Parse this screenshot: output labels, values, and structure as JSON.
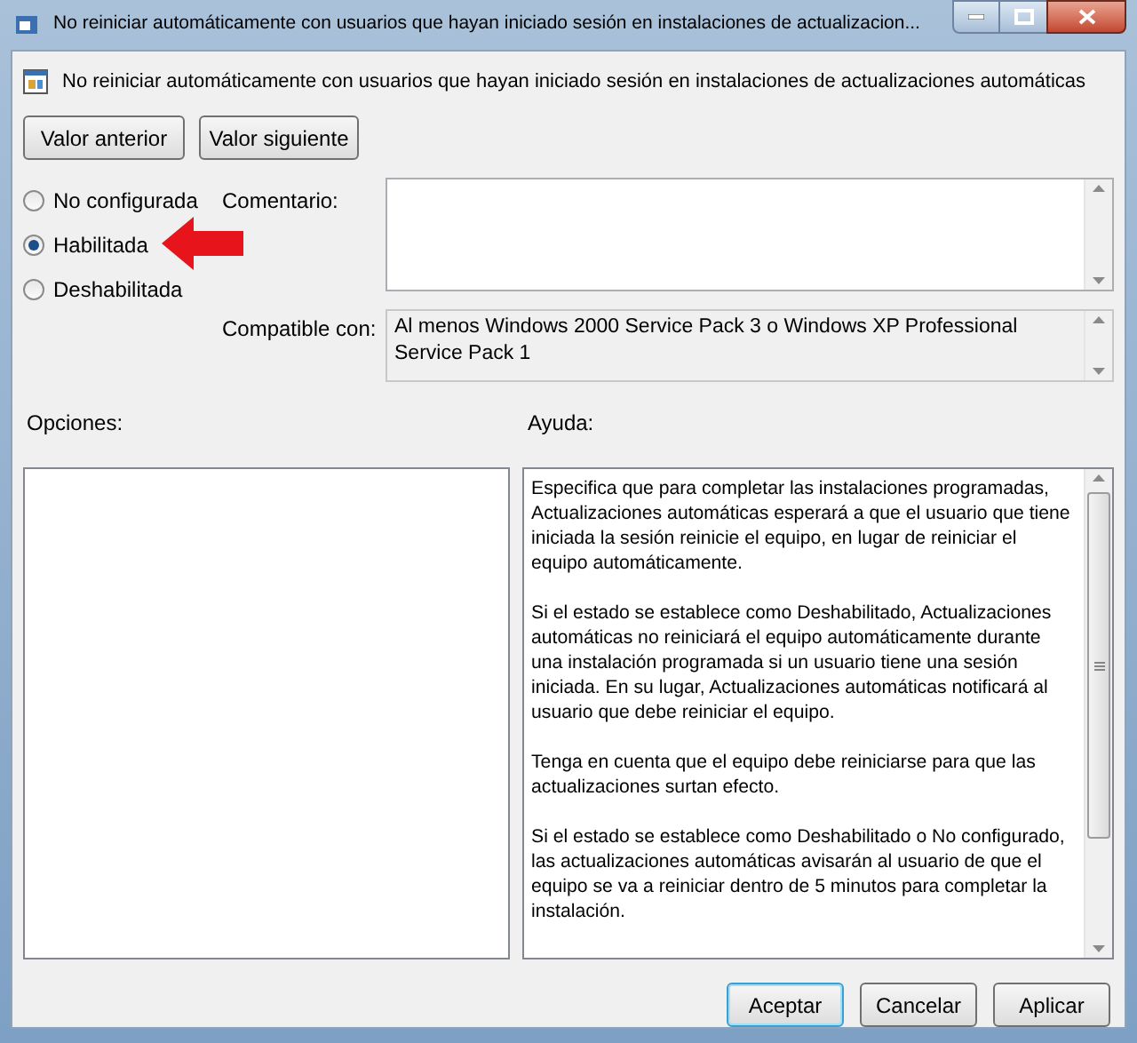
{
  "window": {
    "title": "No reiniciar automáticamente con usuarios que hayan iniciado sesión en instalaciones de actualizacion..."
  },
  "policy_title": "No reiniciar automáticamente con usuarios que hayan iniciado sesión en instalaciones de actualizaciones automáticas",
  "nav_buttons": [
    "Valor anterior",
    "Valor siguiente"
  ],
  "states": [
    {
      "label": "No configurada",
      "selected": false
    },
    {
      "label": "Habilitada",
      "selected": true
    },
    {
      "label": "Deshabilitada",
      "selected": false
    }
  ],
  "comment": {
    "label": "Comentario:"
  },
  "compatible": {
    "label": "Compatible con:",
    "value": "Al menos Windows 2000 Service Pack 3 o Windows XP Professional Service Pack 1"
  },
  "options": {
    "label": "Opciones:"
  },
  "help": {
    "label": "Ayuda:",
    "paragraphs": [
      "Especifica que para completar las instalaciones programadas, Actualizaciones automáticas esperará a que el usuario que tiene iniciada la sesión reinicie el equipo, en lugar de reiniciar el equipo automáticamente.",
      "Si el estado se establece como Deshabilitado, Actualizaciones automáticas no reiniciará el equipo automáticamente durante una instalación programada si un usuario tiene una sesión iniciada. En su lugar, Actualizaciones automáticas notificará al usuario que debe reiniciar el equipo.",
      "Tenga en cuenta que el equipo debe reiniciarse para que las actualizaciones surtan efecto.",
      "Si el estado se establece como Deshabilitado o No configurado, las actualizaciones automáticas avisarán al usuario de que el equipo se va a reiniciar dentro de 5 minutos para completar la instalación."
    ]
  },
  "footer_buttons": [
    {
      "label": "Aceptar",
      "selected": true
    },
    {
      "label": "Cancelar",
      "selected": false
    },
    {
      "label": "Aplicar",
      "selected": false
    }
  ]
}
